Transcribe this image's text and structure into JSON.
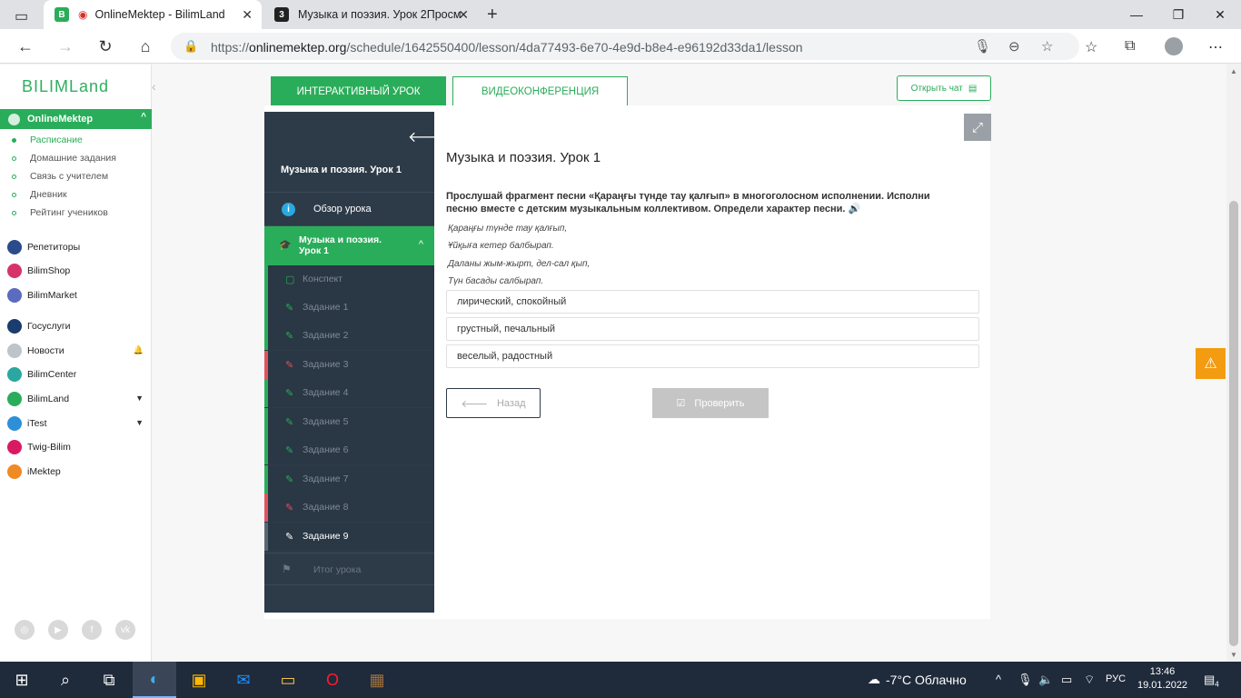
{
  "browser": {
    "tabs": [
      {
        "title": "OnlineMektep - BilimLand",
        "favicon": "B"
      },
      {
        "title": "Музыка и поэзия. Урок 2Просм",
        "favicon": "3"
      }
    ],
    "url_prefix": "https://",
    "url_domain": "onlinemektep.org",
    "url_path": "/schedule/1642550400/lesson/4da77493-6e70-4e9d-b8e4-e96192d33da1/lesson"
  },
  "sidebar": {
    "logo": "BILIMLand",
    "section_header": "OnlineMektep",
    "sub_items": [
      "Расписание",
      "Домашние задания",
      "Связь с учителем",
      "Дневник",
      "Рейтинг учеников"
    ],
    "services": [
      {
        "label": "Репетиторы",
        "color": "#2b4b8c",
        "icon": "tutors-icon"
      },
      {
        "label": "BilimShop",
        "color": "#d6336c",
        "icon": "shop-icon"
      },
      {
        "label": "BilimMarket",
        "color": "#5b6bbf",
        "icon": "market-icon"
      },
      {
        "label": "Госуслуги",
        "color": "#1a3c6e",
        "icon": "gov-icon"
      },
      {
        "label": "Новости",
        "color": "#bfc3cc",
        "icon": "news-icon"
      },
      {
        "label": "BilimCenter",
        "color": "#2aa7a0",
        "icon": "center-icon"
      },
      {
        "label": "BilimLand",
        "color": "#2aad5a",
        "icon": "bilimland-icon"
      },
      {
        "label": "iTest",
        "color": "#2d8fd8",
        "icon": "itest-icon"
      },
      {
        "label": "Twig-Bilim",
        "color": "#d81b60",
        "icon": "twig-icon"
      },
      {
        "label": "iMektep",
        "color": "#f08a24",
        "icon": "imektep-icon"
      }
    ]
  },
  "tabs": {
    "interactive": "ИНТЕРАКТИВНЫЙ УРОК",
    "video": "ВИДЕОКОНФЕРЕНЦИЯ",
    "open_chat": "Открыть чат"
  },
  "lesson_nav": {
    "title": "Музыка и поэзия. Урок 1",
    "overview": "Обзор урока",
    "lesson_label": "Музыка и поэзия. Урок 1",
    "items": [
      {
        "label": "Конспект",
        "status": "done"
      },
      {
        "label": "Задание 1",
        "status": "done"
      },
      {
        "label": "Задание 2",
        "status": "done"
      },
      {
        "label": "Задание 3",
        "status": "wrong"
      },
      {
        "label": "Задание 4",
        "status": "done"
      },
      {
        "label": "Задание 5",
        "status": "done"
      },
      {
        "label": "Задание 6",
        "status": "done"
      },
      {
        "label": "Задание 7",
        "status": "done"
      },
      {
        "label": "Задание 8",
        "status": "wrong"
      },
      {
        "label": "Задание 9",
        "status": "current"
      }
    ],
    "final": "Итог урока"
  },
  "task": {
    "title": "Музыка и поэзия. Урок 1",
    "question": "Прослушай фрагмент песни «Қараңғы түнде тау қалғып» в многоголосном исполнении. Исполни песню вместе с детским музыкальным коллективом. Определи характер песни.",
    "poem": [
      "Қараңғы түнде тау қалғып,",
      "Ұйқыға кетер балбырап.",
      "Даланы жым-жырт, дел-сал қып,",
      "Түн басады салбырап."
    ],
    "options": [
      "лирический, спокойный",
      "грустный, печальный",
      "веселый, радостный"
    ],
    "back": "Назад",
    "check": "Проверить"
  },
  "taskbar": {
    "weather": "-7°C  Облачно",
    "lang": "РУС",
    "time": "13:46",
    "date": "19.01.2022",
    "notifications": "4"
  }
}
